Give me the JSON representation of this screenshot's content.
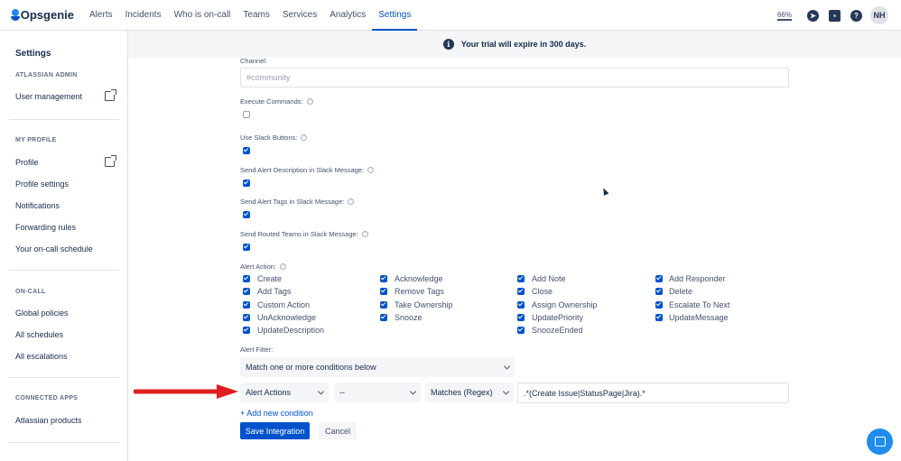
{
  "nav": {
    "logo": "Opsgenie",
    "items": [
      {
        "label": "Alerts"
      },
      {
        "label": "Incidents"
      },
      {
        "label": "Who is on-call"
      },
      {
        "label": "Teams"
      },
      {
        "label": "Services"
      },
      {
        "label": "Analytics"
      },
      {
        "label": "Settings",
        "active": true
      }
    ],
    "zoom": "66%",
    "avatar": "NH"
  },
  "sidebar": {
    "title": "Settings",
    "sections": [
      {
        "heading": "ATLASSIAN ADMIN",
        "items": [
          "User management"
        ]
      },
      {
        "heading": "MY PROFILE",
        "items": [
          "Profile",
          "Profile settings",
          "Notifications",
          "Forwarding rules",
          "Your on-call schedule"
        ]
      },
      {
        "heading": "ON-CALL",
        "items": [
          "Global policies",
          "All schedules",
          "All escalations"
        ]
      },
      {
        "heading": "CONNECTED APPS",
        "items": [
          "Atlassian products"
        ]
      }
    ]
  },
  "banner": {
    "text": "Your trial will expire in 300 days."
  },
  "form": {
    "channel_label": "Channel:",
    "channel_placeholder": "#community",
    "fields": [
      {
        "label": "Execute Commands:",
        "checked": false
      },
      {
        "label": "Use Slack Buttons:",
        "checked": true
      },
      {
        "label": "Send Alert Description in Slack Message:",
        "checked": true
      },
      {
        "label": "Send Alert Tags in Slack Message:",
        "checked": true
      },
      {
        "label": "Send Routed Teams in Slack Message:",
        "checked": true
      }
    ],
    "alert_action_label": "Alert Action:",
    "alert_actions": [
      [
        "Create",
        "Acknowledge",
        "Add Note",
        "Add Responder"
      ],
      [
        "Add Tags",
        "Remove Tags",
        "Close",
        "Delete"
      ],
      [
        "Custom Action",
        "Take Ownership",
        "Assign Ownership",
        "Escalate To Next"
      ],
      [
        "UnAcknowledge",
        "Snooze",
        "UpdatePriority",
        "UpdateMessage"
      ],
      [
        "UpdateDescription",
        "",
        "SnoozeEnded",
        ""
      ]
    ],
    "alert_filter_label": "Alert Filter:",
    "filter_mode": "Match one or more conditions below",
    "condition": {
      "field": "Alert Actions",
      "not": "--",
      "operator": "Matches (Regex)",
      "value": ".*(Create Issue|StatusPage|Jira).*"
    },
    "add_condition": "+ Add new condition",
    "save_button": "Save Integration",
    "cancel_button": "Cancel"
  },
  "colors": {
    "accent": "#0052cc",
    "arrow": "#e01e1e",
    "chat": "#1f8ded"
  },
  "icons": [
    "opsgenie-logo-icon",
    "compass-icon",
    "apps-icon",
    "help-icon",
    "info-icon",
    "external-link-icon",
    "chevron-down-icon",
    "chat-icon",
    "checkbox-icon",
    "red-arrow-annotation"
  ]
}
